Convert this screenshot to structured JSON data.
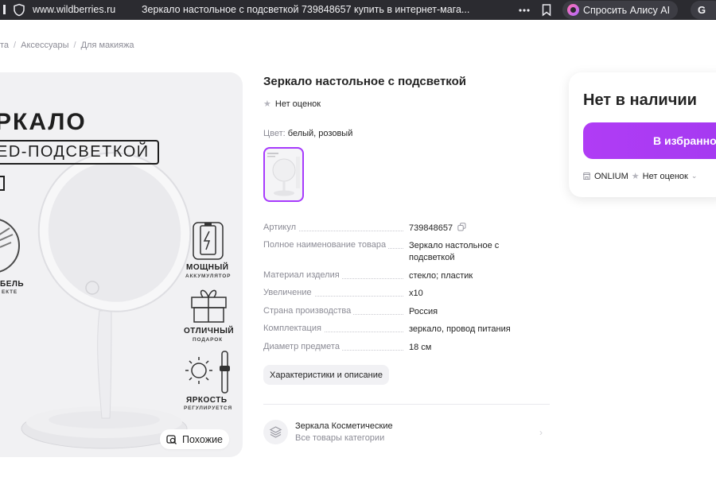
{
  "browser": {
    "domain": "www.wildberries.ru",
    "tab_title": "Зеркало настольное с подсветкой 739848657 купить в интернет-мага...",
    "alice_label": "Спросить Алису AI",
    "ext_glyph": "G"
  },
  "breadcrumb": [
    "та",
    "Аксессуары",
    "Для макияжа"
  ],
  "image": {
    "title": "РКАЛО",
    "badge": "ED-ПОДСВЕТКОЙ",
    "features": [
      {
        "label": "МОЩНЫЙ",
        "sub": "АККУМУЛЯТОР",
        "icon": "battery-icon"
      },
      {
        "label": "ОТЛИЧНЫЙ",
        "sub": "ПОДАРОК",
        "icon": "gift-icon"
      },
      {
        "label": "ЯРКОСТЬ",
        "sub": "РЕГУЛИРУЕТСЯ",
        "icon": "sun-icon"
      }
    ],
    "cable_label": "БЕЛЬ",
    "cable_sub": "ЕКТЕ",
    "similar_label": "Похожие"
  },
  "product": {
    "title": "Зеркало настольное с подсветкой",
    "rating": "Нет оценок",
    "color_label": "Цвет:",
    "color_value": "белый, розовый",
    "specs": [
      {
        "key": "Артикул",
        "value": "739848657"
      },
      {
        "key": "Полное наименование товара",
        "value": "Зеркало настольное с подсветкой"
      },
      {
        "key": "Материал изделия",
        "value": "стекло; пластик"
      },
      {
        "key": "Увеличение",
        "value": "x10"
      },
      {
        "key": "Страна производства",
        "value": "Россия"
      },
      {
        "key": "Комплектация",
        "value": "зеркало, провод питания"
      },
      {
        "key": "Диаметр предмета",
        "value": "18 см"
      }
    ],
    "char_button": "Характеристики и описание",
    "category_name": "Зеркала Косметические",
    "category_sub": "Все товары категории"
  },
  "side": {
    "availability": "Нет в наличии",
    "fav_button": "В избранное",
    "seller": "ONLIUM",
    "seller_rating": "Нет оценок"
  },
  "colors": {
    "accent": "#a73afd",
    "browser_bg": "#2b2b30"
  }
}
